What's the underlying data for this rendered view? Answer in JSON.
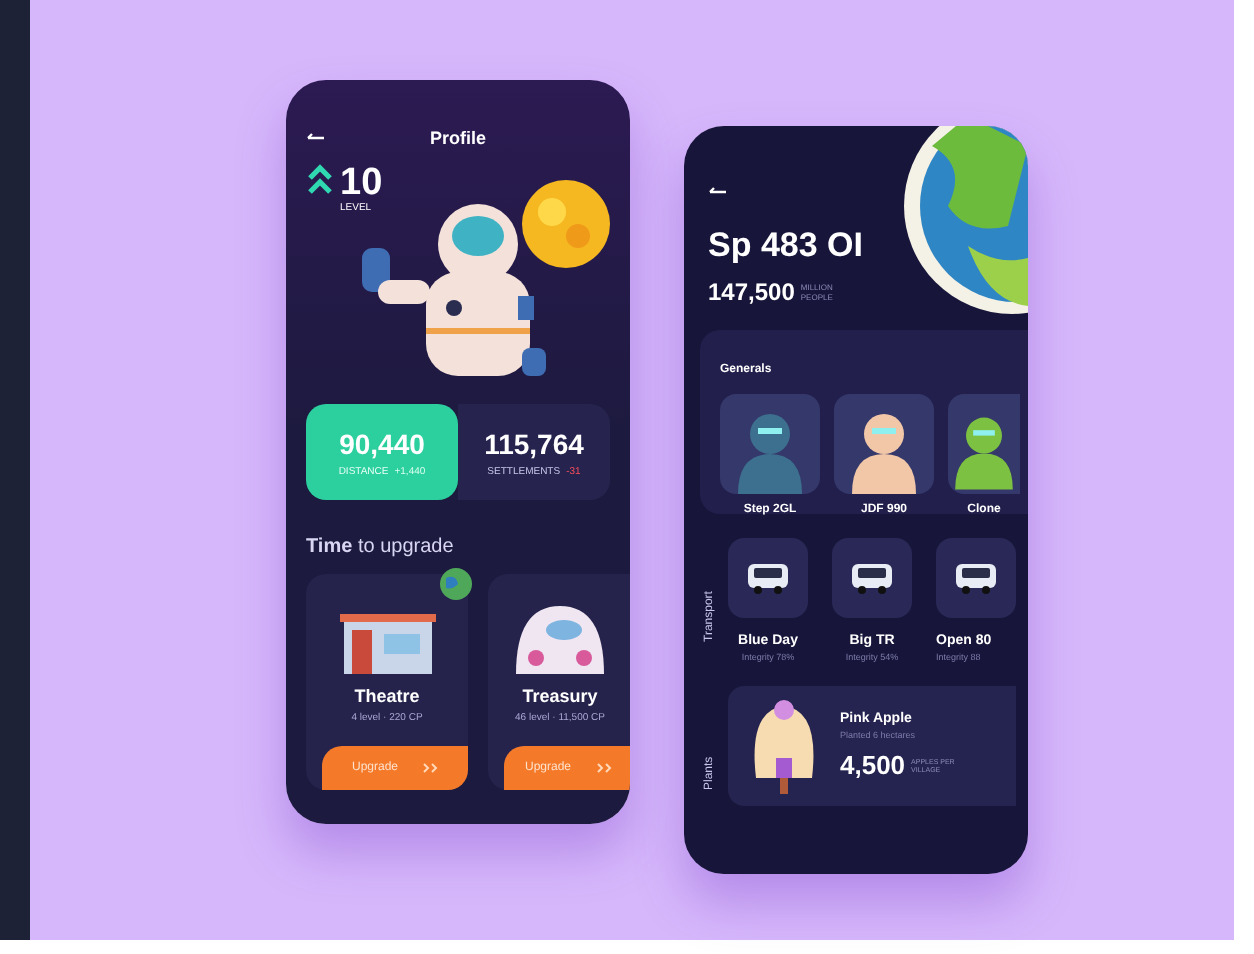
{
  "profile_screen": {
    "title": "Profile",
    "level": {
      "value": "10",
      "label": "LEVEL"
    },
    "stats": [
      {
        "value": "90,440",
        "label": "DISTANCE",
        "delta": "+1,440",
        "kind": "gain",
        "highlighted": true
      },
      {
        "value": "115,764",
        "label": "SETTLEMENTS",
        "delta": "-31",
        "kind": "loss",
        "highlighted": false
      }
    ],
    "section_title": "**Time** to upgrade",
    "buildings": [
      {
        "kind": "house",
        "name": "Theatre",
        "info": "4 level · 220 CP",
        "button": "Upgrade"
      },
      {
        "kind": "dome",
        "name": "Treasury",
        "info": "46 level · 11,500 CP",
        "button": "Upgrade"
      }
    ]
  },
  "planet_screen": {
    "name": "Sp 483 OI",
    "population": "147,500",
    "population_unit": "MILLION PEOPLE",
    "generals": {
      "title": "Generals",
      "items": [
        {
          "name": "Step 2GL",
          "color": "#3d6f8e"
        },
        {
          "name": "JDF 990",
          "color": "#f2c7a8"
        },
        {
          "name": "Clone",
          "color": "#7cc142"
        }
      ]
    },
    "transport": {
      "title": "Transport",
      "items": [
        {
          "name": "Blue Day",
          "integrity": "Integrity 78%"
        },
        {
          "name": "Big TR",
          "integrity": "Integrity 54%"
        },
        {
          "name": "Open 80",
          "integrity": "Integrity 88"
        }
      ]
    },
    "plants": {
      "title": "Plants",
      "items": [
        {
          "name": "Pink Apple",
          "info": "Planted 6 hectares",
          "amount": "4,500",
          "unit": "APPLES PER VILLAGE"
        }
      ]
    }
  }
}
